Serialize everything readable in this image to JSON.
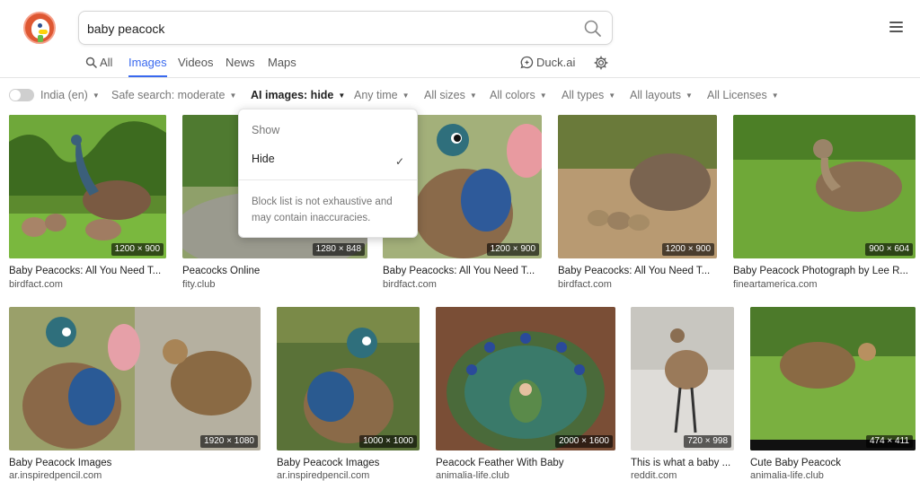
{
  "search": {
    "query": "baby peacock"
  },
  "tabs": [
    {
      "label": "All"
    },
    {
      "label": "Images"
    },
    {
      "label": "Videos"
    },
    {
      "label": "News"
    },
    {
      "label": "Maps"
    }
  ],
  "duckai": {
    "label": "Duck.ai"
  },
  "filters": {
    "region": "India (en)",
    "safe_search": "Safe search: moderate",
    "ai_images": "AI images: hide",
    "time": "Any time",
    "size": "All sizes",
    "color": "All colors",
    "type": "All types",
    "layout": "All layouts",
    "license": "All Licenses"
  },
  "ai_dropdown": {
    "options": [
      {
        "label": "Show"
      },
      {
        "label": "Hide"
      }
    ],
    "selected": "Hide",
    "note": "Block list is not exhaustive and may contain inaccuracies."
  },
  "results": [
    {
      "title": "Baby Peacocks: All You Need T...",
      "source": "birdfact.com",
      "dims": "1200 × 900"
    },
    {
      "title": "Peacocks Online",
      "source": "fity.club",
      "dims": "1280 × 848"
    },
    {
      "title": "Baby Peacocks: All You Need T...",
      "source": "birdfact.com",
      "dims": "1200 × 900"
    },
    {
      "title": "Baby Peacocks: All You Need T...",
      "source": "birdfact.com",
      "dims": "1200 × 900"
    },
    {
      "title": "Baby Peacock Photograph by Lee R...",
      "source": "fineartamerica.com",
      "dims": "900 × 604"
    },
    {
      "title": "Baby Peacock Images",
      "source": "ar.inspiredpencil.com",
      "dims": "1920 × 1080"
    },
    {
      "title": "Baby Peacock Images",
      "source": "ar.inspiredpencil.com",
      "dims": "1000 × 1000"
    },
    {
      "title": "Peacock Feather With Baby",
      "source": "animalia-life.club",
      "dims": "2000 × 1600"
    },
    {
      "title": "This is what a baby ...",
      "source": "reddit.com",
      "dims": "720 × 998"
    },
    {
      "title": "Cute Baby Peacock",
      "source": "animalia-life.club",
      "dims": "474 × 411"
    }
  ],
  "colors": {
    "accent": "#3969ef",
    "logo": "#de5833"
  }
}
